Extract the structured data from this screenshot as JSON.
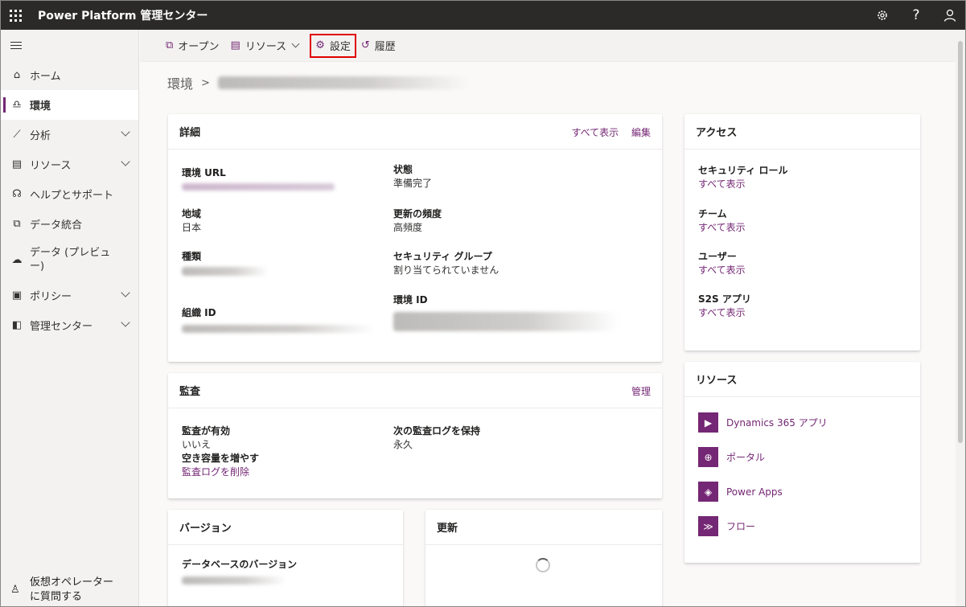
{
  "topbar": {
    "app_title": "Power Platform 管理センター",
    "icons": [
      "waffle-icon",
      "gear-icon",
      "help-icon",
      "user-icon"
    ],
    "help_glyph": "?"
  },
  "sidebar": {
    "items": [
      {
        "label": "ホーム",
        "icon": "home-icon"
      },
      {
        "label": "環境",
        "icon": "environments-icon",
        "active": true
      },
      {
        "label": "分析",
        "icon": "analytics-icon",
        "expandable": true
      },
      {
        "label": "リソース",
        "icon": "resources-icon",
        "expandable": true
      },
      {
        "label": "ヘルプとサポート",
        "icon": "support-icon"
      },
      {
        "label": "データ統合",
        "icon": "data-integration-icon"
      },
      {
        "label": "データ (プレビュー)",
        "line1": "データ (プレビュ",
        "line2": "ー)",
        "icon": "data-preview-icon"
      },
      {
        "label": "ポリシー",
        "icon": "policies-icon",
        "expandable": true
      },
      {
        "label": "管理センター",
        "icon": "admin-centers-icon",
        "expandable": true
      }
    ],
    "bottom": {
      "line1": "仮想オペレーター",
      "line2": "に質問する",
      "icon": "virtual-agent-icon"
    }
  },
  "commandbar": {
    "open": "オープン",
    "resources": "リソース",
    "settings": "設定",
    "history": "履歴"
  },
  "breadcrumb": {
    "root": "環境",
    "separator": ">"
  },
  "details": {
    "title": "詳細",
    "see_all": "すべて表示",
    "edit": "編集",
    "env_url_label": "環境 URL",
    "state_label": "状態",
    "state_value": "準備完了",
    "region_label": "地域",
    "region_value": "日本",
    "update_cadence_label": "更新の頻度",
    "update_cadence_value": "高頻度",
    "type_label": "種類",
    "security_group_label": "セキュリティ グループ",
    "security_group_value": "割り当てられていません",
    "org_id_label": "組織 ID",
    "env_id_label": "環境 ID"
  },
  "audit": {
    "title": "監査",
    "manage": "管理",
    "enabled_label": "監査が有効",
    "enabled_value": "いいえ",
    "free_space_label": "空き容量を増やす",
    "delete_logs": "監査ログを削除",
    "retain_label": "次の監査ログを保持",
    "retain_value": "永久"
  },
  "version": {
    "title": "バージョン",
    "db_version_label": "データベースのバージョン"
  },
  "updates": {
    "title": "更新"
  },
  "access": {
    "title": "アクセス",
    "items": [
      {
        "label": "セキュリティ ロール",
        "link": "すべて表示"
      },
      {
        "label": "チーム",
        "link": "すべて表示"
      },
      {
        "label": "ユーザー",
        "link": "すべて表示"
      },
      {
        "label": "S2S アプリ",
        "link": "すべて表示"
      }
    ]
  },
  "resources": {
    "title": "リソース",
    "items": [
      {
        "label": "Dynamics 365 アプリ",
        "icon": "dynamics-icon",
        "glyph": "▶"
      },
      {
        "label": "ポータル",
        "icon": "portal-globe-icon",
        "glyph": "⊕"
      },
      {
        "label": "Power Apps",
        "icon": "powerapps-icon",
        "glyph": "◈"
      },
      {
        "label": "フロー",
        "icon": "flow-icon",
        "glyph": "≫"
      }
    ]
  },
  "colors": {
    "accent": "#742774",
    "highlight": "#e00000",
    "topbar": "#2b2a29"
  }
}
